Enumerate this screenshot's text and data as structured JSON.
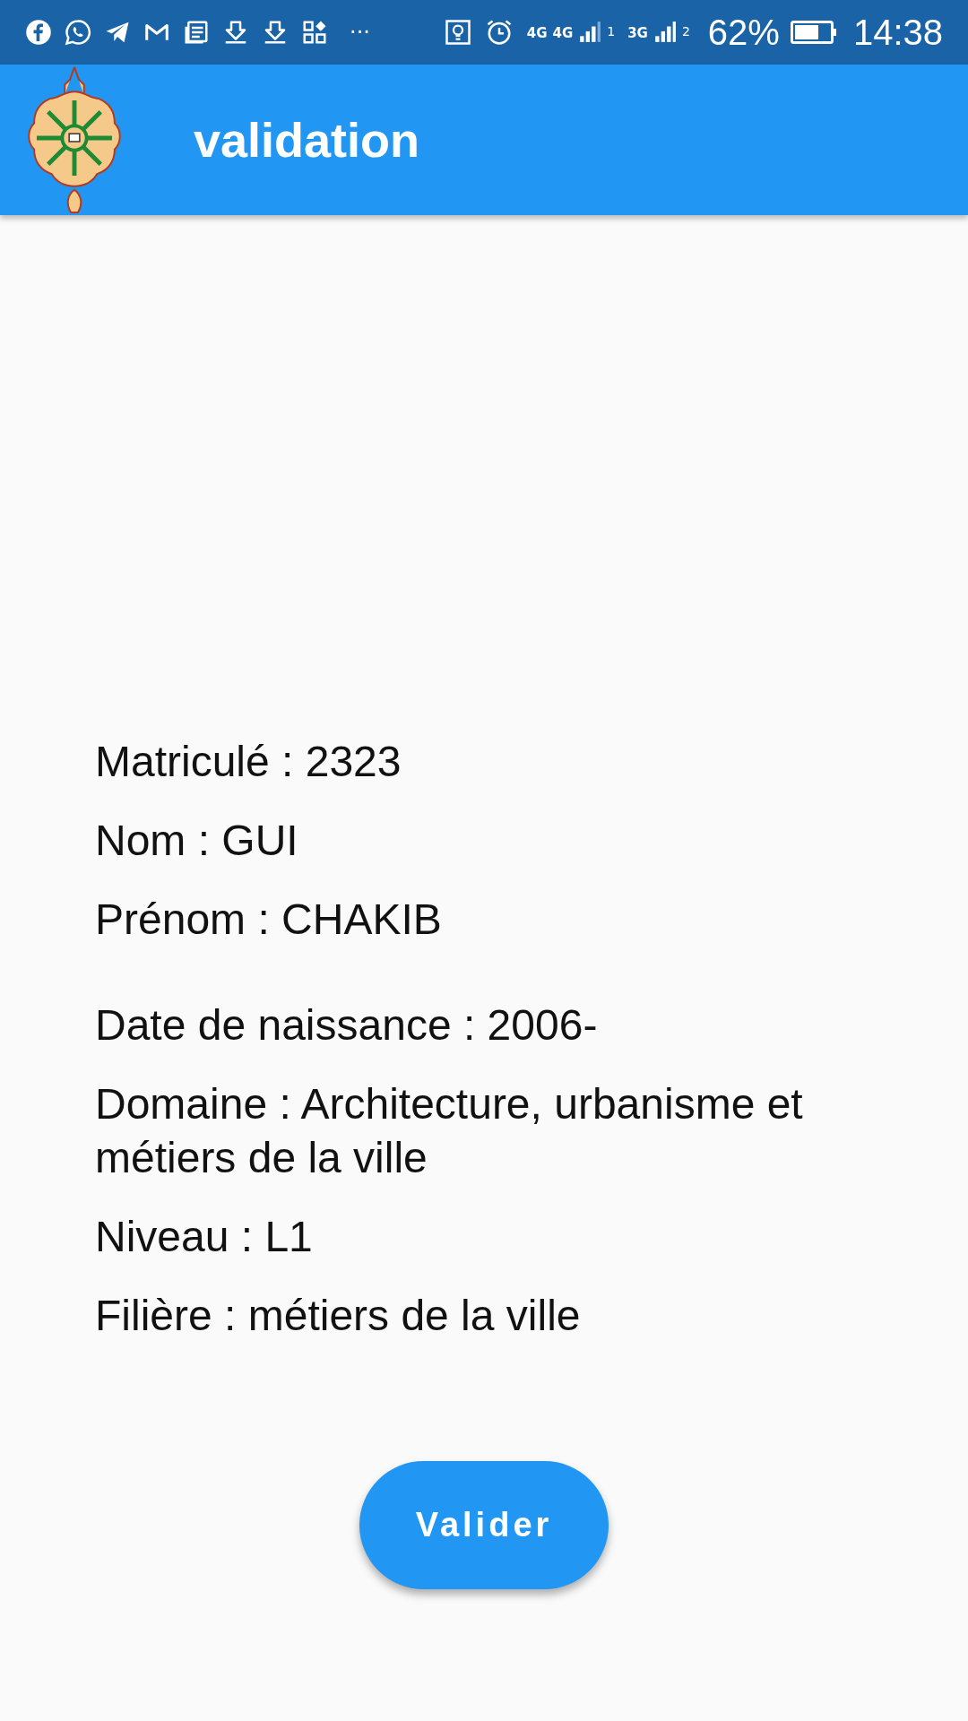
{
  "status_bar": {
    "more": "···",
    "network_1": "4G",
    "network_2": "4G",
    "sim_1": "1",
    "network_3": "3G",
    "sim_2": "2",
    "battery": "62%",
    "time": "14:38"
  },
  "app_bar": {
    "title": "validation"
  },
  "fields": [
    {
      "text": "Matriculé : 2323"
    },
    {
      "text": "Nom : GUI"
    },
    {
      "text": "Prénom : CHAKIB"
    },
    {
      "text": "Date de naissance : 2006-"
    },
    {
      "text": "Domaine : Architecture, urbanisme et métiers de la ville"
    },
    {
      "text": "Niveau : L1"
    },
    {
      "text": "Filière : métiers de la ville"
    }
  ],
  "button": {
    "label": "Valider"
  }
}
